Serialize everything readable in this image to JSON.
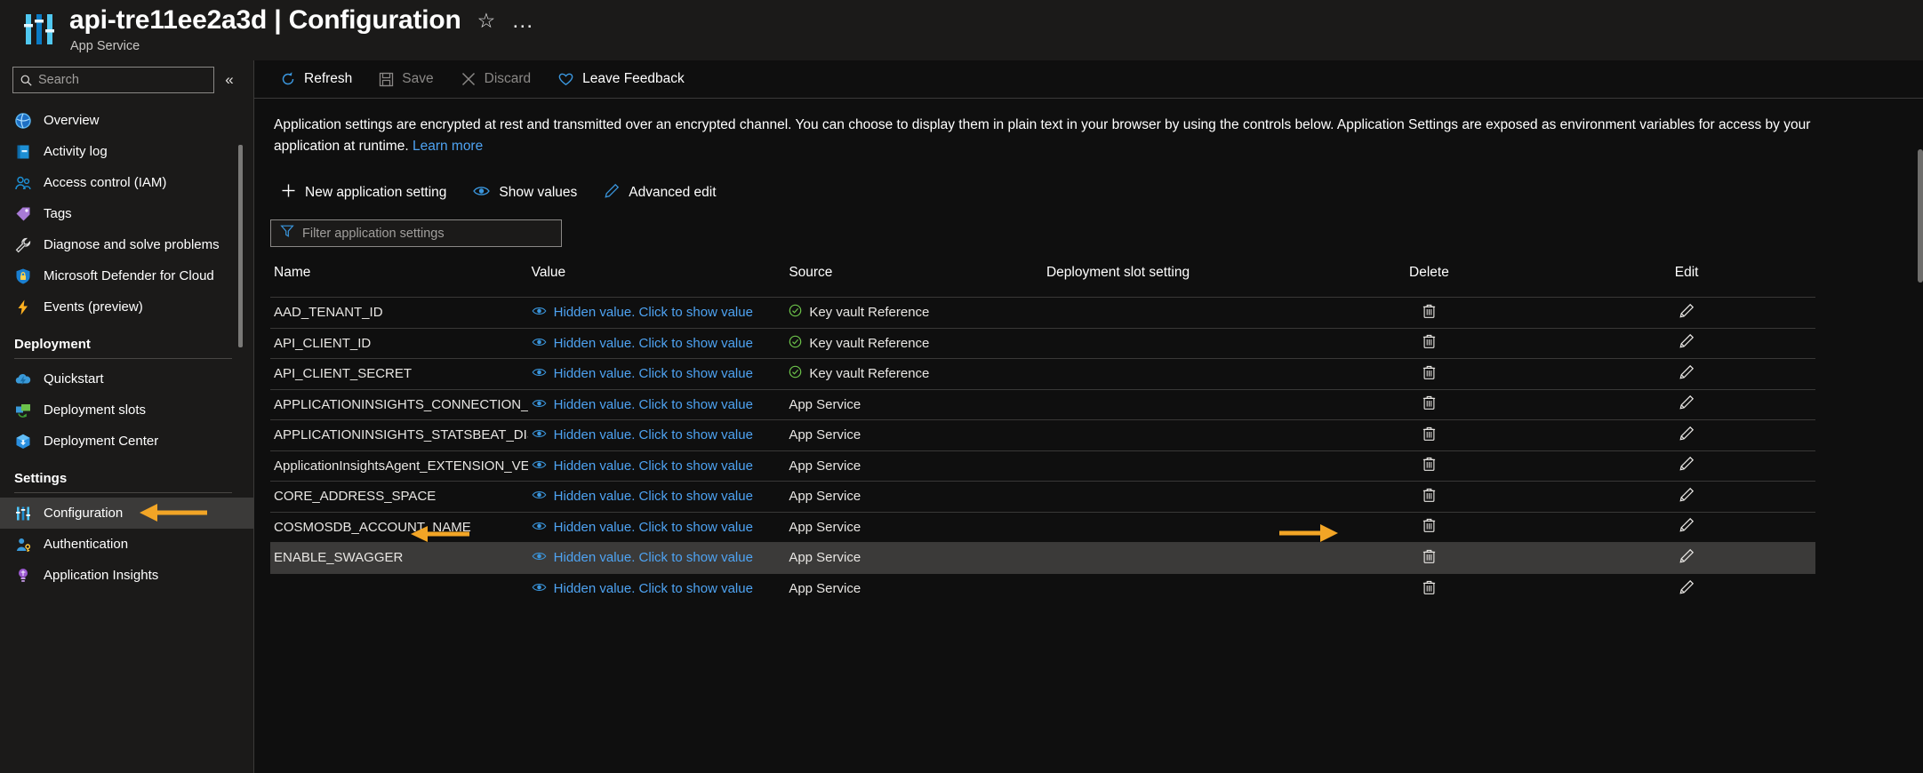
{
  "header": {
    "title": "api-tre11ee2a3d | Configuration",
    "subtitle": "App Service",
    "favorite_icon": "star-icon",
    "more_icon": "ellipsis-icon"
  },
  "sidebar": {
    "search_placeholder": "Search",
    "collapse_label": "«",
    "items": [
      {
        "label": "Overview",
        "icon": "overview-icon",
        "selected": false
      },
      {
        "label": "Activity log",
        "icon": "activity-log-icon",
        "selected": false
      },
      {
        "label": "Access control (IAM)",
        "icon": "access-control-icon",
        "selected": false
      },
      {
        "label": "Tags",
        "icon": "tags-icon",
        "selected": false
      },
      {
        "label": "Diagnose and solve problems",
        "icon": "wrench-icon",
        "selected": false
      },
      {
        "label": "Microsoft Defender for Cloud",
        "icon": "shield-lock-icon",
        "selected": false
      },
      {
        "label": "Events (preview)",
        "icon": "lightning-icon",
        "selected": false
      }
    ],
    "groups": [
      {
        "heading": "Deployment",
        "items": [
          {
            "label": "Quickstart",
            "icon": "quickstart-cloud-icon",
            "selected": false
          },
          {
            "label": "Deployment slots",
            "icon": "deployment-slots-icon",
            "selected": false
          },
          {
            "label": "Deployment Center",
            "icon": "deployment-center-icon",
            "selected": false
          }
        ]
      },
      {
        "heading": "Settings",
        "items": [
          {
            "label": "Configuration",
            "icon": "configuration-sliders-icon",
            "selected": true
          },
          {
            "label": "Authentication",
            "icon": "authentication-user-key-icon",
            "selected": false
          },
          {
            "label": "Application Insights",
            "icon": "application-insights-icon",
            "selected": false
          }
        ]
      }
    ]
  },
  "toolbar": {
    "refresh_label": "Refresh",
    "save_label": "Save",
    "discard_label": "Discard",
    "feedback_label": "Leave Feedback"
  },
  "main": {
    "description_part1": "Application settings are encrypted at rest and transmitted over an encrypted channel. You can choose to display them in plain text in your browser by using the controls below. Application Settings are exposed as environment variables for access by your application at runtime. ",
    "learn_more_label": "Learn more",
    "new_setting_label": "New application setting",
    "show_values_label": "Show values",
    "advanced_edit_label": "Advanced edit",
    "filter_placeholder": "Filter application settings"
  },
  "table": {
    "columns": [
      "Name",
      "Value",
      "Source",
      "Deployment slot setting",
      "Delete",
      "Edit"
    ],
    "hidden_value_label": "Hidden value. Click to show value",
    "rows": [
      {
        "name": "AAD_TENANT_ID",
        "value": "Hidden value. Click to show value",
        "source": "Key vault Reference",
        "source_verified": true,
        "slot": "",
        "highlighted": false
      },
      {
        "name": "API_CLIENT_ID",
        "value": "Hidden value. Click to show value",
        "source": "Key vault Reference",
        "source_verified": true,
        "slot": "",
        "highlighted": false
      },
      {
        "name": "API_CLIENT_SECRET",
        "value": "Hidden value. Click to show value",
        "source": "Key vault Reference",
        "source_verified": true,
        "slot": "",
        "highlighted": false
      },
      {
        "name": "APPLICATIONINSIGHTS_CONNECTION_STRIN",
        "value": "Hidden value. Click to show value",
        "source": "App Service",
        "source_verified": false,
        "slot": "",
        "highlighted": false
      },
      {
        "name": "APPLICATIONINSIGHTS_STATSBEAT_DISABLE",
        "value": "Hidden value. Click to show value",
        "source": "App Service",
        "source_verified": false,
        "slot": "",
        "highlighted": false
      },
      {
        "name": "ApplicationInsightsAgent_EXTENSION_VERSI",
        "value": "Hidden value. Click to show value",
        "source": "App Service",
        "source_verified": false,
        "slot": "",
        "highlighted": false
      },
      {
        "name": "CORE_ADDRESS_SPACE",
        "value": "Hidden value. Click to show value",
        "source": "App Service",
        "source_verified": false,
        "slot": "",
        "highlighted": false
      },
      {
        "name": "COSMOSDB_ACCOUNT_NAME",
        "value": "Hidden value. Click to show value",
        "source": "App Service",
        "source_verified": false,
        "slot": "",
        "highlighted": false
      },
      {
        "name": "ENABLE_SWAGGER",
        "value": "Hidden value. Click to show value",
        "source": "App Service",
        "source_verified": false,
        "slot": "",
        "highlighted": true
      },
      {
        "name": "",
        "value": "Hidden value. Click to show value",
        "source": "App Service",
        "source_verified": false,
        "slot": "",
        "highlighted": false
      }
    ]
  },
  "annotations": {
    "arrow_color": "#f2a526",
    "arrow_configuration_target": "Configuration",
    "arrow_enable_swagger_target": "ENABLE_SWAGGER",
    "arrow_edit_target": "Edit"
  }
}
